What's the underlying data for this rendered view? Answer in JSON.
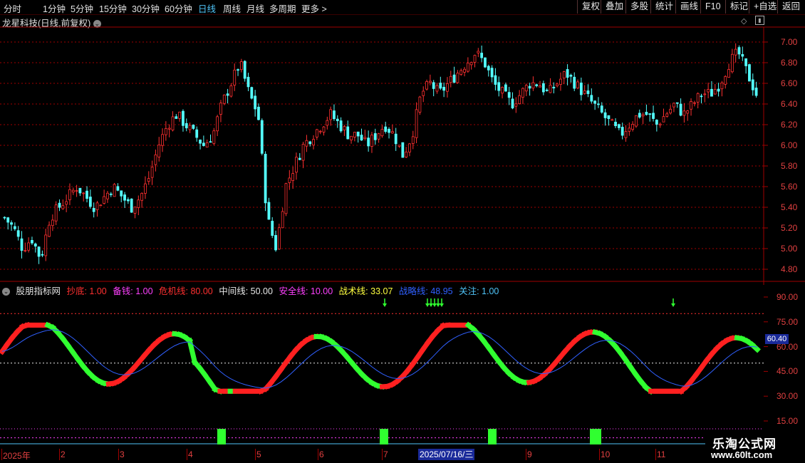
{
  "toolbar": {
    "periods": [
      "分时",
      "1分钟",
      "5分钟",
      "15分钟",
      "30分钟",
      "60分钟",
      "日线",
      "周线",
      "月线",
      "多周期",
      "更多 >"
    ],
    "active_period": "日线",
    "right_buttons": [
      "复权",
      "叠加",
      "多股",
      "统计",
      "画线",
      "F10",
      "标记",
      "+自选",
      "返回"
    ]
  },
  "stock": {
    "title": "龙星科技(日线,前复权)"
  },
  "price_axis": [
    "7.00",
    "6.80",
    "6.60",
    "6.40",
    "6.20",
    "6.00",
    "5.80",
    "5.60",
    "5.40",
    "5.20",
    "5.00",
    "4.80"
  ],
  "indicator": {
    "name": "股朋指标网",
    "items": [
      {
        "label": "抄底: 1.00",
        "color": "#ff3030"
      },
      {
        "label": "备钱: 1.00",
        "color": "#ff40ff"
      },
      {
        "label": "危机线: 80.00",
        "color": "#ff3030"
      },
      {
        "label": "中间线: 50.00",
        "color": "#e8e8e8"
      },
      {
        "label": "安全线: 10.00",
        "color": "#ff40ff"
      },
      {
        "label": "战术线: 33.07",
        "color": "#ffff40"
      },
      {
        "label": "战略线: 48.95",
        "color": "#3060ff"
      },
      {
        "label": "关注: 1.00",
        "color": "#4fc3f7"
      }
    ],
    "axis": [
      "90.00",
      "75.00",
      "60.00",
      "45.00",
      "30.00",
      "15.00"
    ],
    "current_value": "60.40"
  },
  "date_axis": [
    "2025年",
    "2",
    "3",
    "4",
    "5",
    "6",
    "7",
    "9",
    "10",
    "11"
  ],
  "cursor_date": "2025/07/16/三",
  "watermark": {
    "line1": "乐淘公式网",
    "line2": "www.60lt.com"
  },
  "colors": {
    "up": "#ff3030",
    "down": "#54ffff",
    "grid": "#a00000"
  },
  "chart_data": {
    "type": "candlestick",
    "title": "龙星科技(日线,前复权)",
    "ylim": [
      4.75,
      7.1
    ],
    "close_series_approx": [
      5.3,
      5.2,
      5.0,
      5.1,
      4.9,
      5.3,
      5.4,
      5.5,
      5.6,
      5.5,
      5.4,
      5.5,
      5.6,
      5.5,
      5.4,
      5.5,
      5.7,
      6.0,
      6.2,
      6.3,
      6.2,
      6.1,
      6.0,
      6.1,
      6.4,
      6.6,
      6.8,
      6.5,
      6.3,
      5.3,
      5.0,
      5.6,
      5.8,
      6.0,
      6.1,
      6.2,
      6.3,
      6.2,
      6.1,
      6.1,
      6.0,
      6.1,
      6.2,
      6.1,
      5.9,
      6.1,
      6.5,
      6.6,
      6.5,
      6.6,
      6.7,
      6.8,
      6.9,
      6.8,
      6.6,
      6.5,
      6.4,
      6.5,
      6.6,
      6.6,
      6.5,
      6.6,
      6.7,
      6.6,
      6.5,
      6.4,
      6.3,
      6.2,
      6.1,
      6.2,
      6.3,
      6.3,
      6.2,
      6.3,
      6.4,
      6.3,
      6.4,
      6.5,
      6.5,
      6.6,
      6.8,
      6.9,
      6.7,
      6.5
    ]
  }
}
